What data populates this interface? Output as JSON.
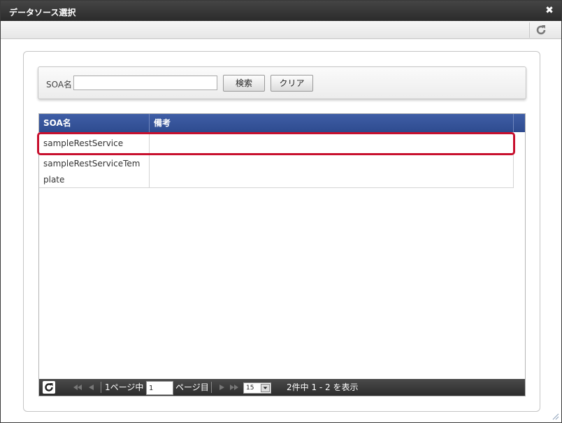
{
  "dialog": {
    "title": "データソース選択",
    "close_icon": "✖"
  },
  "search": {
    "label": "SOA名",
    "value": "",
    "placeholder": "",
    "search_button": "検索",
    "clear_button": "クリア"
  },
  "table": {
    "columns": [
      "SOA名",
      "備考"
    ],
    "rows": [
      {
        "name": "sampleRestService",
        "note": ""
      },
      {
        "name": "sampleRestServiceTemplate",
        "note": ""
      }
    ]
  },
  "pager": {
    "page_prefix": "1ページ中",
    "current_page": "1",
    "page_suffix": "ページ目",
    "page_size": "15",
    "summary": "2件中 1 - 2 を表示"
  },
  "colors": {
    "header": "#2e4b8f",
    "highlight": "#c8102e",
    "titlebar": "#2b2b2b"
  }
}
